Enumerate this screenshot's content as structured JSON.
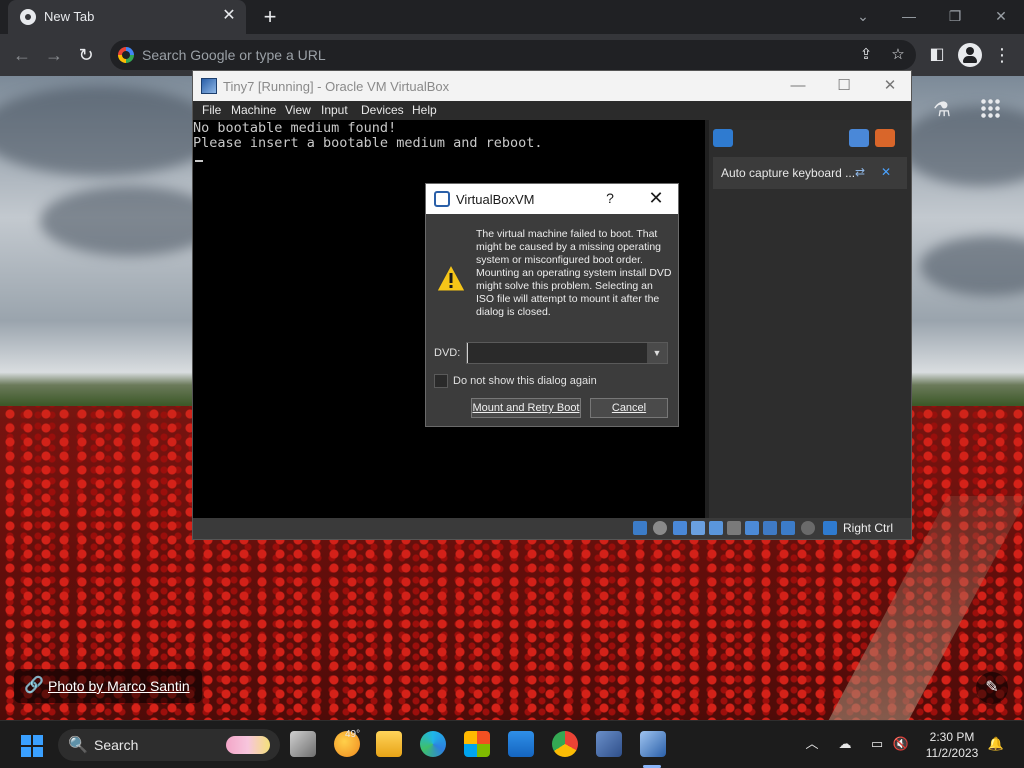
{
  "browser": {
    "tab_title": "New Tab",
    "omnibox_placeholder": "Search Google or type a URL",
    "photo_credit": "Photo by Marco Santin"
  },
  "vbox": {
    "window_title": "Tiny7 [Running] - Oracle VM VirtualBox",
    "menu": [
      "File",
      "Machine",
      "View",
      "Input",
      "Devices",
      "Help"
    ],
    "screen_lines": [
      "No bootable medium found!",
      "Please insert a bootable medium and reboot."
    ],
    "notice_text": "Auto capture keyboard ...",
    "host_key": "Right Ctrl"
  },
  "dialog": {
    "title": "VirtualBoxVM",
    "help_glyph": "?",
    "message": "The virtual machine failed to boot. That might be caused by a missing operating system or misconfigured boot order. Mounting an operating system install DVD might solve this problem. Selecting an ISO file will attempt to mount it after the dialog is closed.",
    "dvd_label": "DVD:",
    "dvd_value": "",
    "checkbox_label": "Do not show this dialog again",
    "mount_button": "Mount and Retry Boot",
    "cancel_button": "Cancel"
  },
  "taskbar": {
    "search_label": "Search",
    "weather_temp": "49°",
    "time": "2:30 PM",
    "date": "11/2/2023"
  },
  "colors": {
    "chrome_dark": "#202124",
    "chrome_toolbar": "#35363a",
    "taskbar": "#1c1c1c",
    "accent_blue": "#3aa0ff"
  }
}
